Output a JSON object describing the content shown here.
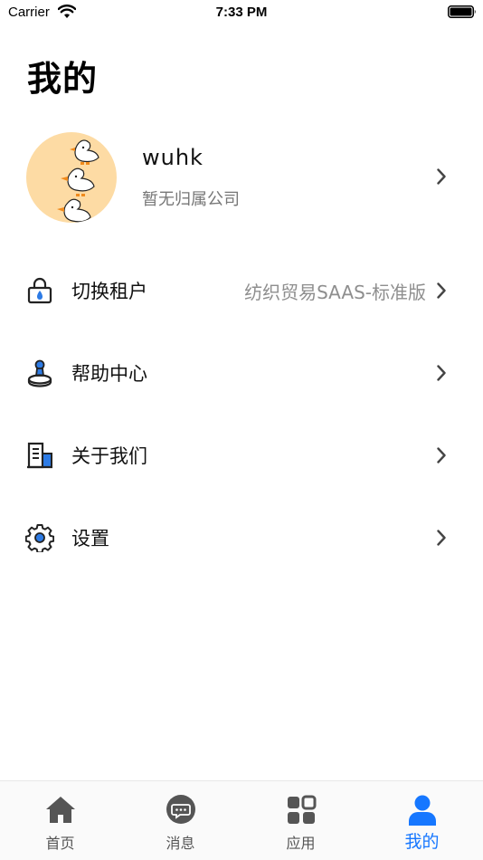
{
  "status_bar": {
    "carrier": "Carrier",
    "time": "7:33 PM"
  },
  "page": {
    "title": "我的"
  },
  "profile": {
    "username": "wuhk",
    "company": "暂无归属公司"
  },
  "menu": [
    {
      "label": "切换租户",
      "value": "纺织贸易SAAS-标准版",
      "icon": "lock-icon"
    },
    {
      "label": "帮助中心",
      "icon": "stamp-icon"
    },
    {
      "label": "关于我们",
      "icon": "building-icon"
    },
    {
      "label": "设置",
      "icon": "gear-icon"
    }
  ],
  "tabs": [
    {
      "label": "首页",
      "icon": "home-icon",
      "active": false
    },
    {
      "label": "消息",
      "icon": "message-icon",
      "active": false
    },
    {
      "label": "应用",
      "icon": "apps-icon",
      "active": false
    },
    {
      "label": "我的",
      "icon": "user-icon",
      "active": true
    }
  ],
  "colors": {
    "accent": "#1677ff",
    "avatar_bg": "#fddba4",
    "icon_blue": "#2d7be5",
    "secondary_text": "#8e8e8e",
    "tab_inactive": "#555555"
  }
}
